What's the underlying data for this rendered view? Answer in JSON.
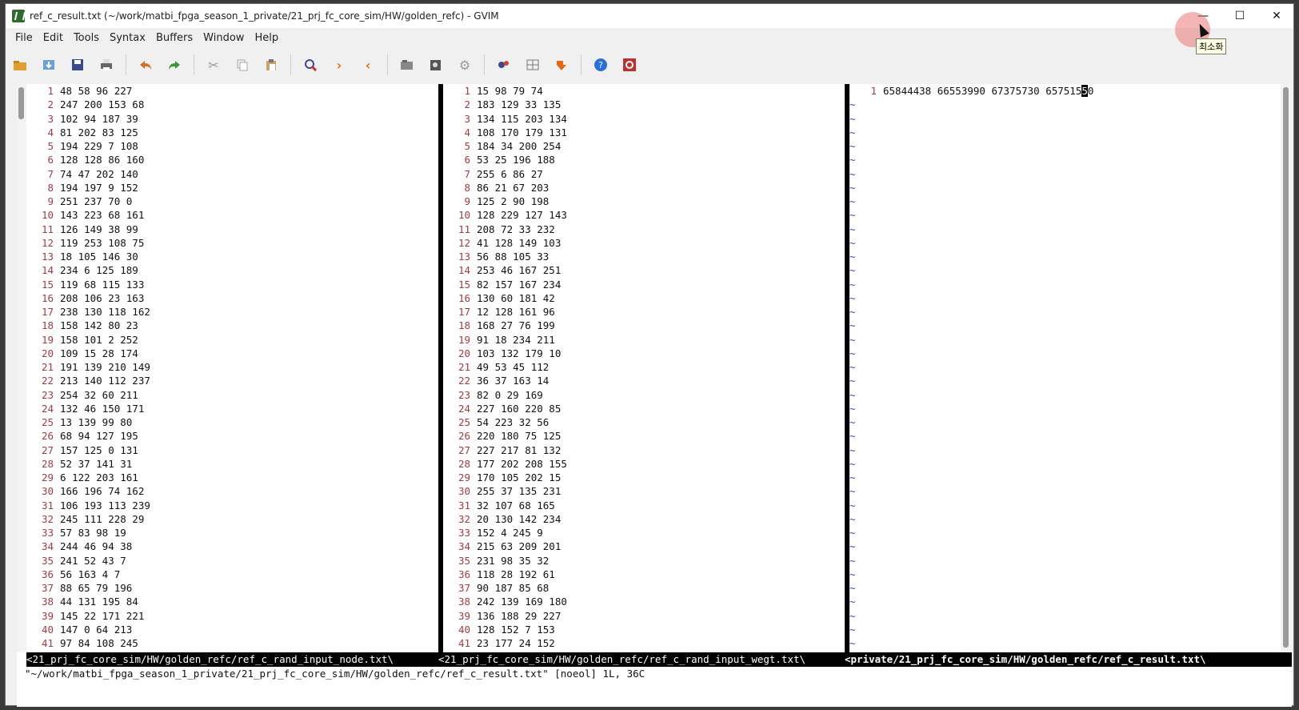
{
  "window": {
    "title": "ref_c_result.txt (~/work/matbi_fpga_season_1_private/21_prj_fc_core_sim/HW/golden_refc) - GVIM",
    "minimize_label": "—",
    "maximize_label": "☐",
    "close_label": "✕",
    "tooltip": "최소화"
  },
  "menu": [
    "File",
    "Edit",
    "Tools",
    "Syntax",
    "Buffers",
    "Window",
    "Help"
  ],
  "toolbar": {
    "icons": [
      "open-icon",
      "load-session-icon",
      "save-icon",
      "print-icon",
      "undo-icon",
      "redo-icon",
      "cut-icon",
      "copy-icon",
      "paste-icon",
      "find-replace-icon",
      "find-next-icon",
      "find-prev-icon",
      "load-script-icon",
      "make-icon",
      "build-tags-icon",
      "shell-icon",
      "make-ctags-icon",
      "jump-tag-icon",
      "help-icon",
      "find-help-icon"
    ],
    "colors": {
      "undo": "#d0702a",
      "redo": "#3a9a3a",
      "nav": "#e06a1a",
      "help": "#2a6ed8"
    }
  },
  "panes": [
    {
      "file": "<21_prj_fc_core_sim/HW/golden_refc/ref_c_rand_input_node.txt\\",
      "lines": [
        "48 58 96 227",
        "247 200 153 68",
        "102 94 187 39",
        "81 202 83 125",
        "194 229 7 108",
        "128 128 86 160",
        "74 47 202 140",
        "194 197 9 152",
        "251 237 70 0",
        "143 223 68 161",
        "126 149 38 99",
        "119 253 108 75",
        "18 105 146 30",
        "234 6 125 189",
        "119 68 115 133",
        "208 106 23 163",
        "238 130 118 162",
        "158 142 80 23",
        "158 101 2 252",
        "109 15 28 174",
        "191 139 210 149",
        "213 140 112 237",
        "254 32 60 211",
        "132 46 150 171",
        "13 139 99 80",
        "68 94 127 195",
        "157 125 0 131",
        "52 37 141 31",
        "6 122 203 161",
        "166 196 74 162",
        "106 193 113 239",
        "245 111 228 29",
        "57 83 98 19",
        "244 46 94 38",
        "241 52 43 7",
        "56 163 4 7",
        "88 65 79 196",
        "44 131 195 84",
        "145 22 171 221",
        "147 0 64 213",
        "97 84 108 245"
      ]
    },
    {
      "file": "<21_prj_fc_core_sim/HW/golden_refc/ref_c_rand_input_wegt.txt\\",
      "lines": [
        "15 98 79 74",
        "183 129 33 135",
        "134 115 203 134",
        "108 170 179 131",
        "184 34 200 254",
        "53 25 196 188",
        "255 6 86 27",
        "86 21 67 203",
        "125 2 90 198",
        "128 229 127 143",
        "208 72 33 232",
        "41 128 149 103",
        "56 88 105 33",
        "253 46 167 251",
        "82 157 167 234",
        "130 60 181 42",
        "12 128 161 96",
        "168 27 76 199",
        "91 18 234 211",
        "103 132 179 10",
        "49 53 45 112",
        "36 37 163 14",
        "82 0 29 169",
        "227 160 220 85",
        "54 223 32 56",
        "220 180 75 125",
        "227 217 81 132",
        "177 202 208 155",
        "170 105 202 15",
        "255 37 135 231",
        "32 107 68 165",
        "20 130 142 234",
        "152 4 245 9",
        "215 63 209 201",
        "231 98 35 32",
        "118 28 192 61",
        "90 187 85 68",
        "242 139 169 180",
        "136 188 29 227",
        "128 152 7 153",
        "23 177 24 152"
      ]
    },
    {
      "file": "<private/21_prj_fc_core_sim/HW/golden_refc/ref_c_result.txt\\",
      "line_before_cursor": "65844438 66553990 67375730 657515",
      "cursor_char": "5",
      "line_after_cursor": "0",
      "tilde": "~"
    }
  ],
  "cmdline": "\"~/work/matbi_fpga_season_1_private/21_prj_fc_core_sim/HW/golden_refc/ref_c_result.txt\" [noeol] 1L, 36C"
}
